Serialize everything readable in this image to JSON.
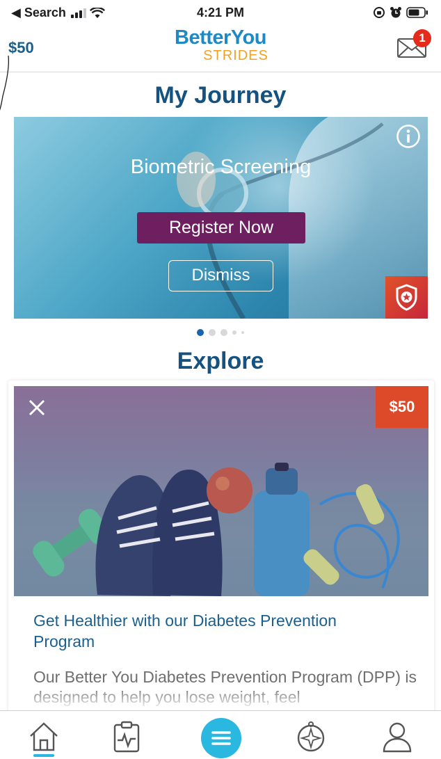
{
  "status_bar": {
    "back_label": "◀ Search",
    "time": "4:21 PM"
  },
  "header": {
    "points": "$50",
    "logo_top": "BetterYou",
    "logo_bottom": "STRIDES",
    "mail_badge_count": "1"
  },
  "journey": {
    "section_title": "My Journey",
    "card_title": "Biometric Screening",
    "register_label": "Register Now",
    "dismiss_label": "Dismiss",
    "carousel_page": 1,
    "carousel_pages": 5
  },
  "explore": {
    "section_title": "Explore",
    "reward": "$50",
    "article_title": "Get Healthier with our Diabetes Prevention Program",
    "article_body": "Our Better You Diabetes Prevention Program (DPP) is designed to help you lose weight, feel"
  },
  "tab_bar": {
    "items": [
      "home-icon",
      "activity-icon",
      "menu-icon",
      "compass-icon",
      "profile-icon"
    ],
    "active": "home"
  },
  "colors": {
    "brand_blue": "#15527f",
    "accent_cyan": "#2ab8e0",
    "register_purple": "#6e1f5f",
    "reward_orange": "#dd4a2a",
    "logo_orange": "#f3a220"
  }
}
